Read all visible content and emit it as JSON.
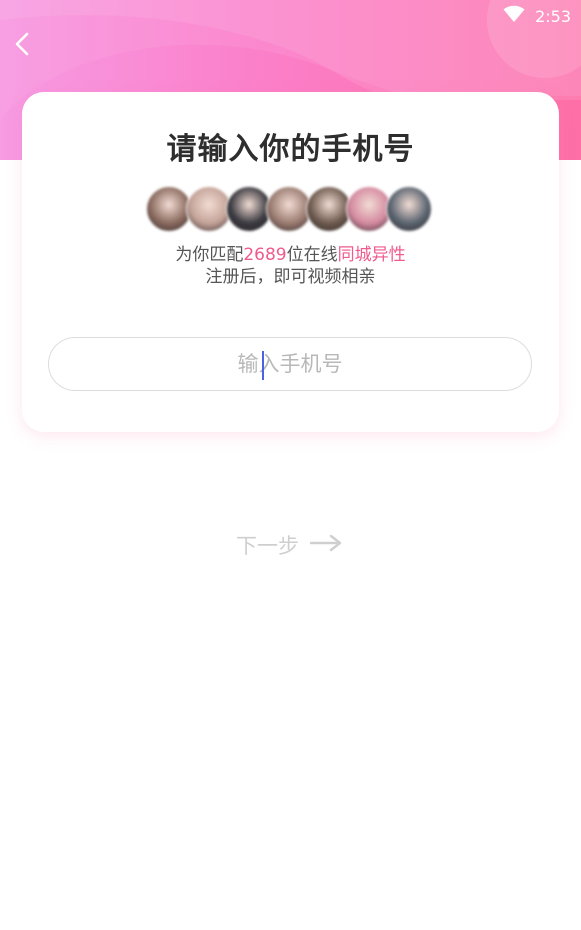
{
  "status_bar": {
    "time": "2:53",
    "wifi_icon": "wifi-icon"
  },
  "nav": {
    "back_icon": "chevron-left-icon"
  },
  "card": {
    "title": "请输入你的手机号",
    "avatars": [
      {
        "color": "#8a6a5e"
      },
      {
        "color": "#c4a398"
      },
      {
        "color": "#3a3a40"
      },
      {
        "color": "#9a7b70"
      },
      {
        "color": "#6e5a4e"
      },
      {
        "color": "#d48aa0"
      },
      {
        "color": "#5a6470"
      }
    ],
    "match_prefix": "为你匹配",
    "match_count": "2689",
    "match_middle": "位在线",
    "match_highlight": "同城异性",
    "sub_text": "注册后，即可视频相亲",
    "highlight_color": "#f05a8c"
  },
  "phone_input": {
    "placeholder": "输入手机号",
    "value": ""
  },
  "next_button": {
    "label": "下一步",
    "icon": "arrow-right-icon"
  },
  "colors": {
    "header_gradient_start": "#f79be3",
    "header_gradient_end": "#fd6fa6"
  }
}
